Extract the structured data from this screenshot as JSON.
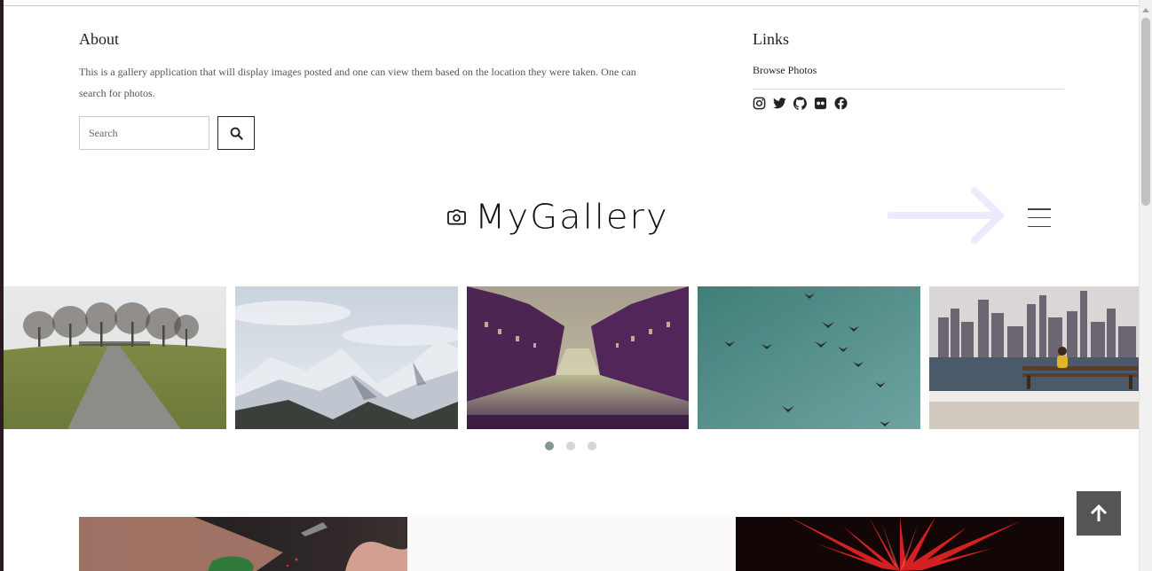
{
  "about": {
    "heading": "About",
    "text": "This is a gallery application that will display images posted and one can view them based on the location they were taken. One can search for photos."
  },
  "search": {
    "placeholder": "Search",
    "value": ""
  },
  "links": {
    "heading": "Links",
    "items": [
      "Browse Photos"
    ],
    "socials": [
      "instagram-icon",
      "twitter-icon",
      "github-icon",
      "flickr-icon",
      "facebook-icon"
    ]
  },
  "brand": {
    "name": "MyGallery",
    "icon": "camera-icon"
  },
  "carousel": {
    "slides": [
      "field-path-trees",
      "snowy-mountains",
      "canal-city-night",
      "birds-sky",
      "city-skyline-bench"
    ],
    "dots": 3,
    "active_dot": 0
  },
  "colors": {
    "accent_arrow": "#ecebfb",
    "dot_active": "#869791",
    "dot_inactive": "#d6d6d6",
    "to_top_bg": "#555555"
  }
}
